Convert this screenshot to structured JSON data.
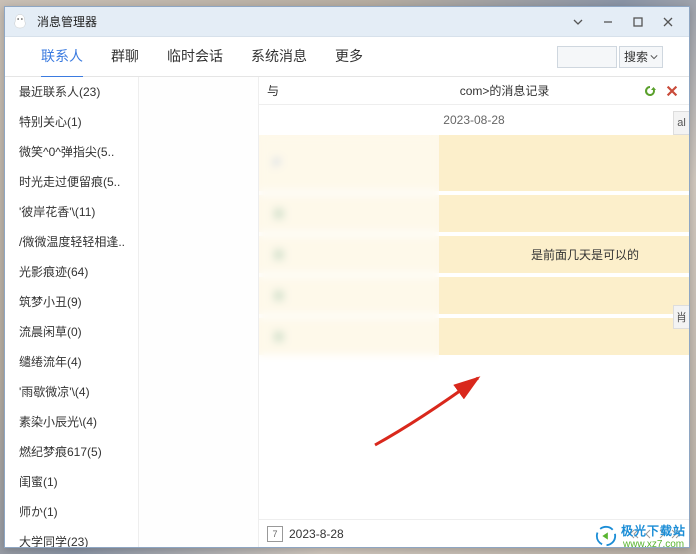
{
  "window": {
    "title": "消息管理器"
  },
  "tabs": {
    "items": [
      "联系人",
      "群聊",
      "临时会话",
      "系统消息",
      "更多"
    ],
    "active_index": 0,
    "search_btn": "搜索"
  },
  "sidebar": {
    "items": [
      "最近联系人(23)",
      "特别关心(1)",
      "微笑^0^弹指尖(5..",
      "时光走过便留痕(5..",
      "'彼岸花香'\\(11)",
      "/微微温度轻轻相逢..",
      "光影痕迹(64)",
      "筑梦小丑(9)",
      "流晨闲草(0)",
      "缱绻流年(4)",
      "'雨歇微凉'\\(4)",
      "素染小辰光\\(4)",
      "燃纪梦痕617(5)",
      "闺蜜(1)",
      "师か(1)",
      "大学同学(23)"
    ]
  },
  "chat": {
    "header_prefix": "与",
    "header_mid": "com>的消息记录",
    "date_label": "2023-08-28",
    "messages": [
      {
        "senderInitial": "P",
        "senderColor": "blue",
        "body": "",
        "tall": true
      },
      {
        "senderInitial": "故",
        "senderColor": "green",
        "body": ""
      },
      {
        "senderInitial": "故",
        "senderColor": "green",
        "body": "是前面几天是可以的"
      },
      {
        "senderInitial": "故",
        "senderColor": "green",
        "body": ""
      },
      {
        "senderInitial": "故",
        "senderColor": "green",
        "body": ""
      }
    ],
    "footer_date": "2023-8-28",
    "edge_labels": {
      "top": "al",
      "bottom": "肖"
    }
  },
  "watermark": {
    "cn": "极光下载站",
    "en": "www.xz7.com"
  }
}
